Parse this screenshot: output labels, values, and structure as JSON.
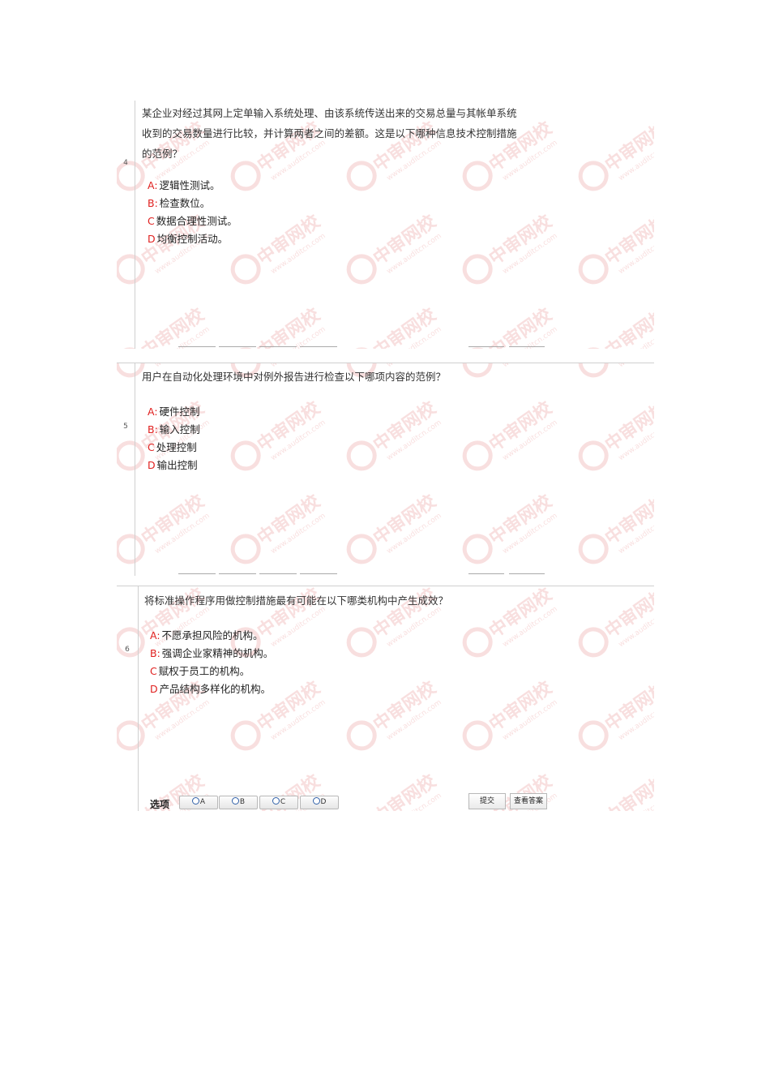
{
  "watermark": {
    "brand": "中审网校",
    "site": "www.auditcn.com",
    "color": "#f4c6c6"
  },
  "accent_color": "#e0201f",
  "questions": [
    {
      "number": "4",
      "lines": [
        "某企业对经过其网上定单输入系统处理、由该系统传送出来的交易总量与其帐单系统",
        "收到的交易数量进行比较，并计算两者之间的差额。这是以下哪种信息技术控制措施",
        "的范例？"
      ],
      "options": [
        {
          "key": "A:",
          "text": "逻辑性测试。"
        },
        {
          "key": "B:",
          "text": "检查数位。"
        },
        {
          "key": "C",
          "text": "数据合理性测试。"
        },
        {
          "key": "D",
          "text": "均衡控制活动。"
        }
      ]
    },
    {
      "number": "5",
      "lines": [
        "用户在自动化处理环境中对例外报告进行检查以下哪项内容的范例？"
      ],
      "options": [
        {
          "key": "A:",
          "text": "硬件控制"
        },
        {
          "key": "B:",
          "text": "输入控制"
        },
        {
          "key": "C",
          "text": "处理控制"
        },
        {
          "key": "D",
          "text": "输出控制"
        }
      ]
    },
    {
      "number": "6",
      "lines": [
        "将标准操作程序用做控制措施最有可能在以下哪类机构中产生成效？"
      ],
      "options": [
        {
          "key": "A:",
          "text": "不愿承担风险的机构。"
        },
        {
          "key": "B:",
          "text": "强调企业家精神的机构。"
        },
        {
          "key": "C",
          "text": "赋权于员工的机构。"
        },
        {
          "key": "D",
          "text": "产品结构多样化的机构。"
        }
      ]
    }
  ],
  "answer_bar": {
    "label": "选项",
    "choices": [
      "A",
      "B",
      "C",
      "D"
    ],
    "submit": "提交",
    "view_answer": "查看答案"
  }
}
